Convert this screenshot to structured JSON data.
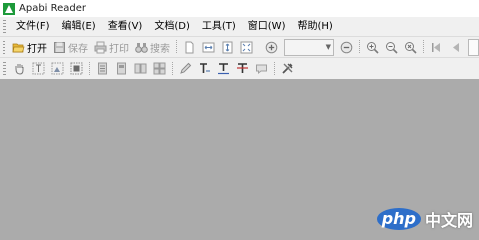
{
  "window": {
    "title": "Apabi Reader"
  },
  "menu": [
    "文件(F)",
    "编辑(E)",
    "查看(V)",
    "文档(D)",
    "工具(T)",
    "窗口(W)",
    "帮助(H)"
  ],
  "toolbar1": {
    "open_label": "打开",
    "save_label": "保存",
    "print_label": "打印",
    "search_label": "搜索",
    "zoom_value": ""
  },
  "watermark": {
    "logo": "php",
    "text": "中文网"
  },
  "colors": {
    "workspace": "#ababab",
    "toolbar": "#f0f0f0",
    "accent": "#2d6ec9"
  }
}
